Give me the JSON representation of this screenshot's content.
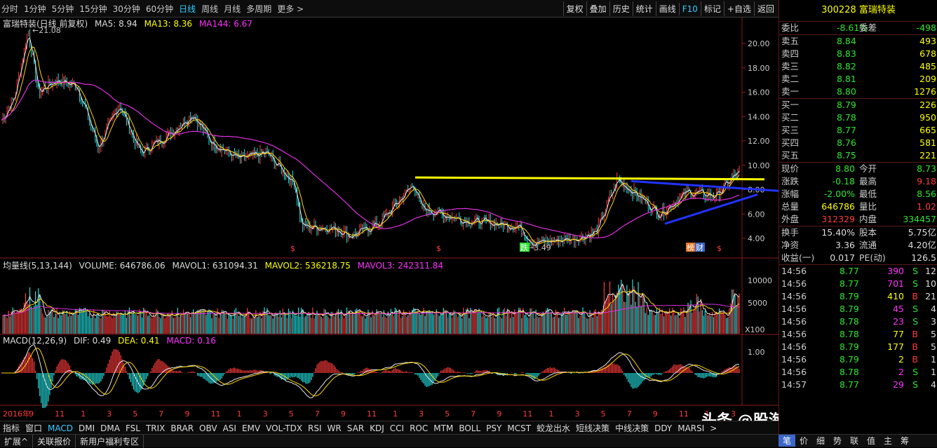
{
  "toolbar": {
    "periods": [
      "分时",
      "1分钟",
      "5分钟",
      "15分钟",
      "30分钟",
      "60分钟",
      "日线",
      "周线",
      "月线",
      "多周期",
      "更多 >"
    ],
    "active_period": 6,
    "tools": [
      "复权",
      "叠加",
      "历史",
      "统计",
      "画线",
      "F10",
      "标记",
      "+自选",
      "返回"
    ]
  },
  "price_panel": {
    "title": "富瑞特装(日线 前复权)",
    "ma5": "MA5: 8.94",
    "ma13": "MA13: 8.36",
    "ma144": "MA144: 6.67",
    "high_label": "21.08",
    "low_label": "3.49",
    "yticks": [
      "20.00",
      "18.00",
      "16.00",
      "14.00",
      "12.00",
      "10.00",
      "8.00",
      "6.00",
      "4.00"
    ],
    "markers": [
      "$",
      "$",
      "跌",
      "榜",
      "财",
      "$"
    ]
  },
  "volume_panel": {
    "title": "均量线(5,13,144)",
    "volume": "VOLUME: 646786.06",
    "mavol1": "MAVOL1: 631094.31",
    "mavol2": "MAVOL2: 536218.75",
    "mavol3": "MAVOL3: 242311.84",
    "yticks": [
      "10000",
      "5000"
    ],
    "unit": "X100"
  },
  "macd_panel": {
    "title": "MACD(12,26,9)",
    "dif": "DIF: 0.49",
    "dea": "DEA: 0.41",
    "macd": "MACD: 0.16",
    "yticks": [
      "1.00"
    ]
  },
  "x_axis": [
    "2016年",
    "9",
    "11",
    "1",
    "3",
    "5",
    "7",
    "9",
    "11",
    "1",
    "3",
    "5",
    "7",
    "9",
    "11",
    "1",
    "3",
    "5",
    "7",
    "9",
    "11",
    "1",
    "3",
    "5",
    "7",
    "9",
    "11",
    "1",
    "3"
  ],
  "indicator_tabs": [
    "指标",
    "窗口",
    "MACD",
    "DMI",
    "DMA",
    "FSL",
    "TRIX",
    "BRAR",
    "OBV",
    "ASI",
    "EMV",
    "VOL-TDX",
    "RSI",
    "WR",
    "SAR",
    "KDJ",
    "CCI",
    "ROC",
    "MTM",
    "BOLL",
    "PSY",
    "MCST",
    "蛟龙出水",
    "短线决策",
    "中线决策",
    "DDY",
    "MARSI",
    ">"
  ],
  "active_indicator": 2,
  "bottom_tabs": [
    "扩展^",
    "关联报价",
    "新用户福利专区"
  ],
  "quote": {
    "code_name": "300228 富瑞特装",
    "weibi_label": "委比",
    "weibi": "-8.61%",
    "weicha_label": "委差",
    "weicha": "-498",
    "asks": [
      {
        "label": "卖五",
        "price": "8.84",
        "vol": "493"
      },
      {
        "label": "卖四",
        "price": "8.83",
        "vol": "678"
      },
      {
        "label": "卖三",
        "price": "8.82",
        "vol": "485"
      },
      {
        "label": "卖二",
        "price": "8.81",
        "vol": "209"
      },
      {
        "label": "卖一",
        "price": "8.80",
        "vol": "1276"
      }
    ],
    "bids": [
      {
        "label": "买一",
        "price": "8.79",
        "vol": "226"
      },
      {
        "label": "买二",
        "price": "8.78",
        "vol": "950"
      },
      {
        "label": "买三",
        "price": "8.77",
        "vol": "665"
      },
      {
        "label": "买四",
        "price": "8.76",
        "vol": "581"
      },
      {
        "label": "买五",
        "price": "8.75",
        "vol": "221"
      }
    ],
    "stats": [
      {
        "k1": "现价",
        "v1": "8.80",
        "c1": "green",
        "k2": "今开",
        "v2": "8.73",
        "c2": "green"
      },
      {
        "k1": "涨跌",
        "v1": "-0.18",
        "c1": "green",
        "k2": "最高",
        "v2": "9.18",
        "c2": "red"
      },
      {
        "k1": "涨幅",
        "v1": "-2.00%",
        "c1": "green",
        "k2": "最低",
        "v2": "8.56",
        "c2": "green"
      },
      {
        "k1": "总量",
        "v1": "646786",
        "c1": "yellow",
        "k2": "量比",
        "v2": "1.02",
        "c2": "red"
      },
      {
        "k1": "外盘",
        "v1": "312329",
        "c1": "red",
        "k2": "内盘",
        "v2": "334457",
        "c2": "green"
      }
    ],
    "stats2": [
      {
        "k1": "换手",
        "v1": "15.40%",
        "k2": "股本",
        "v2": "5.75亿"
      },
      {
        "k1": "净资",
        "v1": "3.36",
        "k2": "流通",
        "v2": "4.20亿"
      },
      {
        "k1": "收益(一)",
        "v1": "0.017",
        "k2": "PE(动)",
        "v2": "126.5"
      }
    ],
    "ticks": [
      {
        "t": "14:56",
        "p": "8.77",
        "v": "390",
        "s": "S",
        "n": "12"
      },
      {
        "t": "14:56",
        "p": "8.77",
        "v": "701",
        "s": "S",
        "n": "10"
      },
      {
        "t": "14:56",
        "p": "8.79",
        "v": "410",
        "s": "B",
        "n": "21"
      },
      {
        "t": "14:56",
        "p": "8.79",
        "v": "45",
        "s": "S",
        "n": "4"
      },
      {
        "t": "14:56",
        "p": "8.78",
        "v": "23",
        "s": "S",
        "n": "3"
      },
      {
        "t": "14:56",
        "p": "8.78",
        "v": "77",
        "s": "B",
        "n": "5"
      },
      {
        "t": "14:56",
        "p": "8.79",
        "v": "177",
        "s": "B",
        "n": "5"
      },
      {
        "t": "14:56",
        "p": "8.79",
        "v": "2",
        "s": "B",
        "n": "1"
      },
      {
        "t": "14:56",
        "p": "8.78",
        "v": "2",
        "s": "S",
        "n": "1"
      },
      {
        "t": "14:57",
        "p": "8.77",
        "v": "29",
        "s": "S",
        "n": "4"
      }
    ]
  },
  "right_tabs": [
    "笔",
    "价",
    "细",
    "势",
    "联",
    "值",
    "主",
    "筹"
  ],
  "active_right_tab": 0,
  "watermark": "头条 @股海修禅趋势"
}
